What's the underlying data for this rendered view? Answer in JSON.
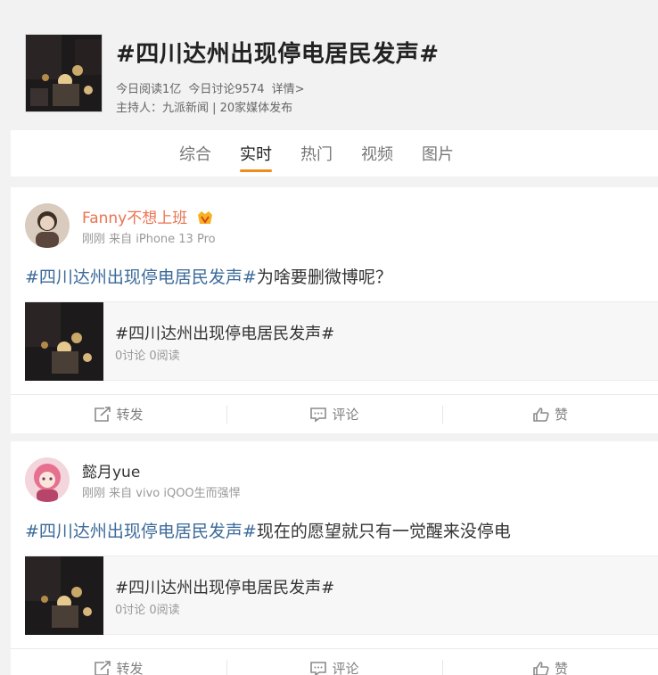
{
  "topic": {
    "title": "#四川达州出现停电居民发声#",
    "reads": "今日阅读1亿",
    "discussions": "今日讨论9574",
    "details_link": "详情>",
    "host": "主持人：九派新闻 | 20家媒体发布"
  },
  "tabs": [
    {
      "label": "综合",
      "active": false
    },
    {
      "label": "实时",
      "active": true
    },
    {
      "label": "热门",
      "active": false
    },
    {
      "label": "视频",
      "active": false
    },
    {
      "label": "图片",
      "active": false
    }
  ],
  "posts": [
    {
      "author": "Fanny不想上班",
      "meta": "刚刚 来自 iPhone 13 Pro",
      "hashtag": "#四川达州出现停电居民发声#",
      "text": "为啥要删微博呢？",
      "share_title": "#四川达州出现停电居民发声#",
      "share_stats": "0讨论 0阅读"
    },
    {
      "author": "懿月yue",
      "meta": "刚刚 来自 vivo iQOO生而强悍",
      "hashtag": "#四川达州出现停电居民发声#",
      "text": "现在的愿望就只有一觉醒来没停电",
      "share_title": "#四川达州出现停电居民发声#",
      "share_stats": "0讨论 0阅读"
    }
  ],
  "actions": {
    "repost": "转发",
    "comment": "评论",
    "like": "赞"
  },
  "colors": {
    "accent": "#f08c1a",
    "hashtag": "#3b6a99",
    "author_vip": "#eb7350"
  }
}
